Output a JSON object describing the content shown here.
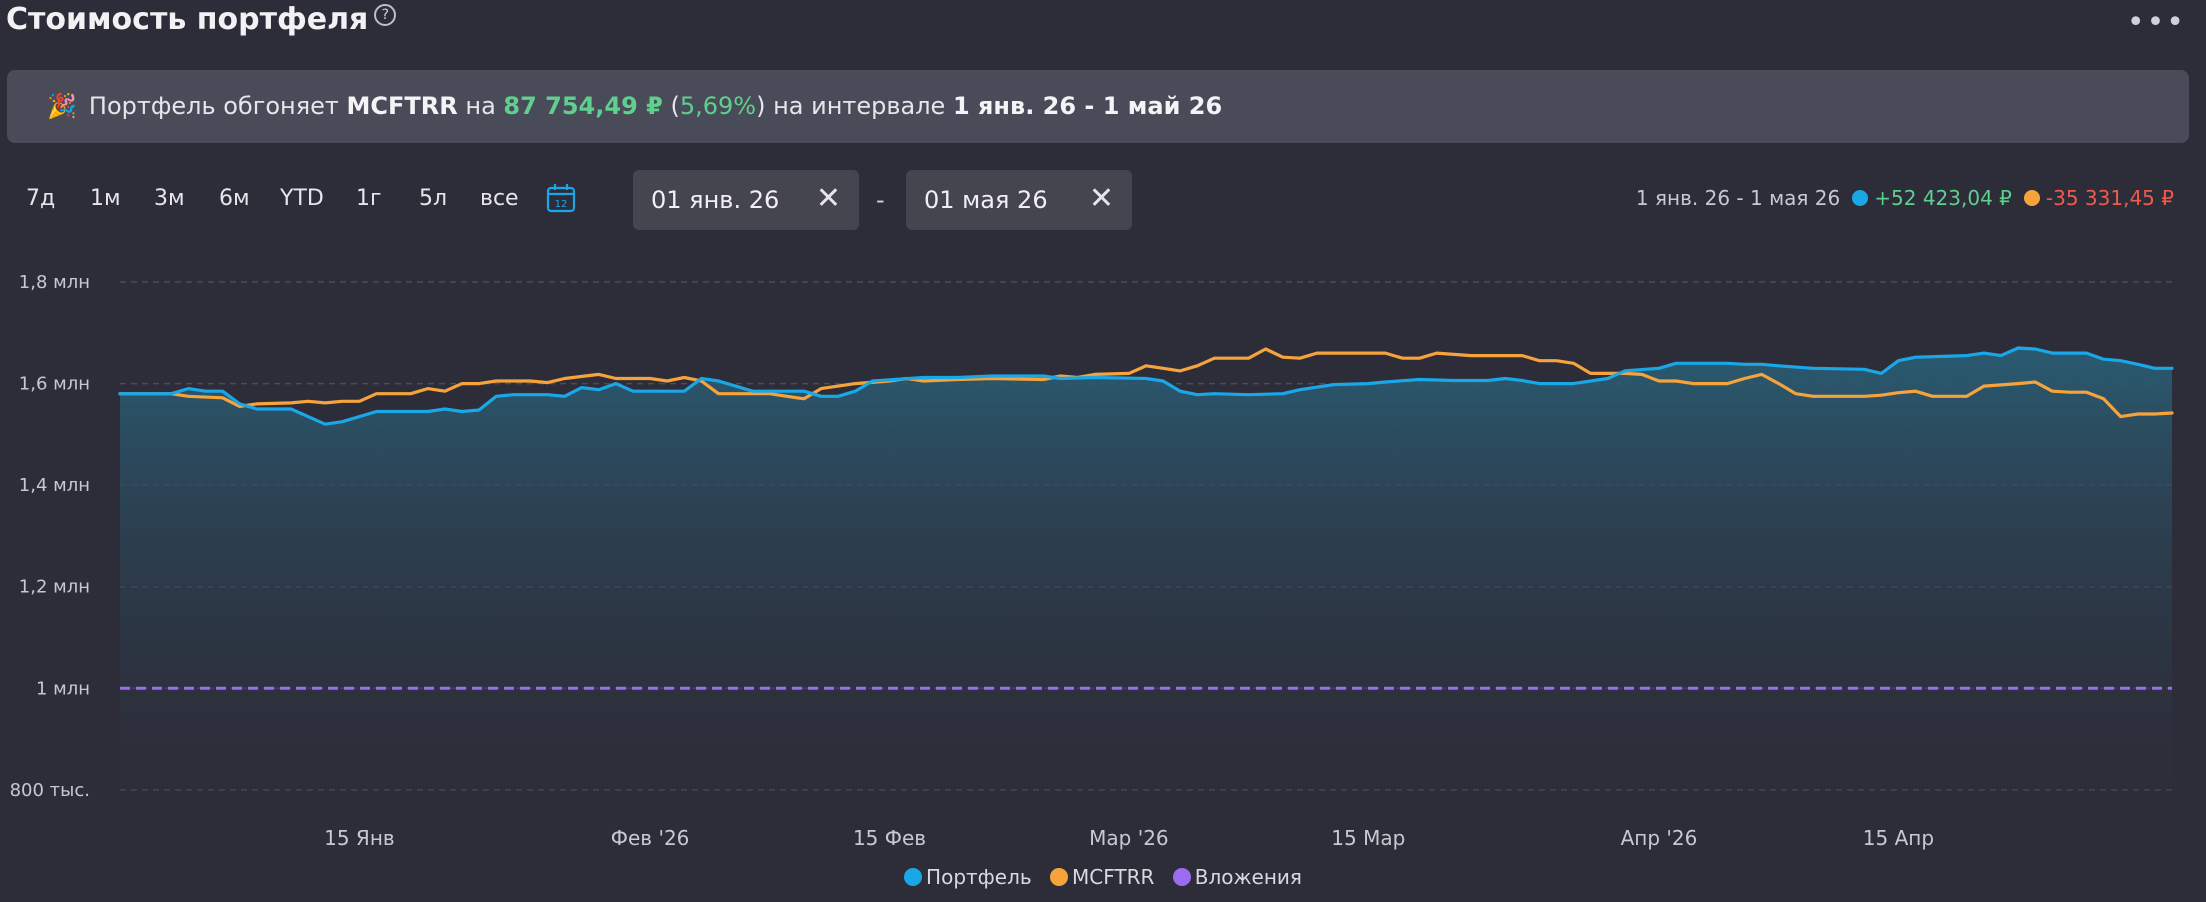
{
  "header": {
    "title": "Стоимость портфеля",
    "help_icon": "?",
    "more_icon": "•••"
  },
  "banner": {
    "emoji": "🎉",
    "t1": "Портфель обгоняет ",
    "benchmark": "MCFTRR",
    "t2": " на ",
    "amount": "87 754,49 ₽",
    "t3": " (",
    "pct": "5,69%",
    "t4": ") на интервале ",
    "interval": "1 янв. 26 - 1 май 26"
  },
  "ranges": [
    "7д",
    "1м",
    "3м",
    "6м",
    "YTD",
    "1г",
    "5л",
    "все"
  ],
  "calendar_icon": "12",
  "date_from": "01 янв. 26",
  "date_to": "01 мая 26",
  "date_sep": "-",
  "summary": {
    "interval": "1 янв. 26 - 1 мая 26",
    "portfolio_change": "+52 423,04 ₽",
    "benchmark_change": "-35 331,45 ₽"
  },
  "colors": {
    "portfolio": "#1aa7e8",
    "benchmark": "#f7a33b",
    "investments": "#9b6cf0",
    "area_top": "#2a5d74",
    "area_bottom": "#2d2d39",
    "grid": "#4b4c5a",
    "positive": "#5fcf8e",
    "negative": "#f05a4a"
  },
  "chart_data": {
    "type": "line",
    "y_ticks": [
      "1,8 млн",
      "1,6 млн",
      "1,4 млн",
      "1,2 млн",
      "1 млн",
      "800 тыс."
    ],
    "y_tick_values": [
      1800000,
      1600000,
      1400000,
      1200000,
      1000000,
      800000
    ],
    "ylim": [
      780000,
      1800000
    ],
    "xlim": [
      "2026-01-01",
      "2026-05-01"
    ],
    "x_ticks": [
      {
        "date": "2026-01-15",
        "label": "15 Янв"
      },
      {
        "date": "2026-02-01",
        "label": "Фев '26"
      },
      {
        "date": "2026-02-15",
        "label": "15 Фев"
      },
      {
        "date": "2026-03-01",
        "label": "Мар '26"
      },
      {
        "date": "2026-03-15",
        "label": "15 Мар"
      },
      {
        "date": "2026-04-01",
        "label": "Апр '26"
      },
      {
        "date": "2026-04-15",
        "label": "15 Апр"
      }
    ],
    "series": [
      {
        "name": "Портфель",
        "area": true,
        "points": [
          [
            "2026-01-01",
            1580000
          ],
          [
            "2026-01-04",
            1580000
          ],
          [
            "2026-01-05",
            1590000
          ],
          [
            "2026-01-06",
            1585000
          ],
          [
            "2026-01-07",
            1585000
          ],
          [
            "2026-01-08",
            1560000
          ],
          [
            "2026-01-09",
            1550000
          ],
          [
            "2026-01-11",
            1550000
          ],
          [
            "2026-01-13",
            1520000
          ],
          [
            "2026-01-14",
            1525000
          ],
          [
            "2026-01-16",
            1545000
          ],
          [
            "2026-01-19",
            1545000
          ],
          [
            "2026-01-20",
            1550000
          ],
          [
            "2026-01-21",
            1545000
          ],
          [
            "2026-01-22",
            1548000
          ],
          [
            "2026-01-23",
            1575000
          ],
          [
            "2026-01-24",
            1578000
          ],
          [
            "2026-01-26",
            1578000
          ],
          [
            "2026-01-27",
            1575000
          ],
          [
            "2026-01-28",
            1592000
          ],
          [
            "2026-01-29",
            1588000
          ],
          [
            "2026-01-30",
            1600000
          ],
          [
            "2026-01-31",
            1585000
          ],
          [
            "2026-02-03",
            1585000
          ],
          [
            "2026-02-04",
            1610000
          ],
          [
            "2026-02-05",
            1605000
          ],
          [
            "2026-02-07",
            1585000
          ],
          [
            "2026-02-10",
            1585000
          ],
          [
            "2026-02-11",
            1575000
          ],
          [
            "2026-02-12",
            1575000
          ],
          [
            "2026-02-13",
            1585000
          ],
          [
            "2026-02-14",
            1605000
          ],
          [
            "2026-02-17",
            1612000
          ],
          [
            "2026-02-19",
            1612000
          ],
          [
            "2026-02-21",
            1615000
          ],
          [
            "2026-02-24",
            1615000
          ],
          [
            "2026-02-25",
            1610000
          ],
          [
            "2026-02-27",
            1612000
          ],
          [
            "2026-03-02",
            1610000
          ],
          [
            "2026-03-03",
            1605000
          ],
          [
            "2026-03-04",
            1585000
          ],
          [
            "2026-03-05",
            1578000
          ],
          [
            "2026-03-06",
            1580000
          ],
          [
            "2026-03-08",
            1578000
          ],
          [
            "2026-03-10",
            1580000
          ],
          [
            "2026-03-11",
            1588000
          ],
          [
            "2026-03-13",
            1598000
          ],
          [
            "2026-03-15",
            1600000
          ],
          [
            "2026-03-16",
            1603000
          ],
          [
            "2026-03-18",
            1608000
          ],
          [
            "2026-03-20",
            1606000
          ],
          [
            "2026-03-22",
            1606000
          ],
          [
            "2026-03-23",
            1610000
          ],
          [
            "2026-03-24",
            1606000
          ],
          [
            "2026-03-25",
            1600000
          ],
          [
            "2026-03-27",
            1600000
          ],
          [
            "2026-03-29",
            1610000
          ],
          [
            "2026-03-30",
            1625000
          ],
          [
            "2026-04-01",
            1630000
          ],
          [
            "2026-04-02",
            1640000
          ],
          [
            "2026-04-05",
            1640000
          ],
          [
            "2026-04-06",
            1638000
          ],
          [
            "2026-04-07",
            1638000
          ],
          [
            "2026-04-08",
            1635000
          ],
          [
            "2026-04-10",
            1630000
          ],
          [
            "2026-04-13",
            1628000
          ],
          [
            "2026-04-14",
            1620000
          ],
          [
            "2026-04-15",
            1645000
          ],
          [
            "2026-04-16",
            1652000
          ],
          [
            "2026-04-19",
            1655000
          ],
          [
            "2026-04-20",
            1660000
          ],
          [
            "2026-04-21",
            1655000
          ],
          [
            "2026-04-22",
            1670000
          ],
          [
            "2026-04-23",
            1668000
          ],
          [
            "2026-04-24",
            1660000
          ],
          [
            "2026-04-26",
            1660000
          ],
          [
            "2026-04-27",
            1648000
          ],
          [
            "2026-04-28",
            1645000
          ],
          [
            "2026-04-29",
            1638000
          ],
          [
            "2026-04-30",
            1630000
          ],
          [
            "2026-05-01",
            1630000
          ]
        ]
      },
      {
        "name": "MCFTRR",
        "points": [
          [
            "2026-01-01",
            1580000
          ],
          [
            "2026-01-04",
            1580000
          ],
          [
            "2026-01-05",
            1575000
          ],
          [
            "2026-01-07",
            1572000
          ],
          [
            "2026-01-08",
            1555000
          ],
          [
            "2026-01-09",
            1560000
          ],
          [
            "2026-01-11",
            1562000
          ],
          [
            "2026-01-12",
            1565000
          ],
          [
            "2026-01-13",
            1562000
          ],
          [
            "2026-01-14",
            1565000
          ],
          [
            "2026-01-15",
            1565000
          ],
          [
            "2026-01-16",
            1580000
          ],
          [
            "2026-01-18",
            1580000
          ],
          [
            "2026-01-19",
            1590000
          ],
          [
            "2026-01-20",
            1585000
          ],
          [
            "2026-01-21",
            1600000
          ],
          [
            "2026-01-22",
            1600000
          ],
          [
            "2026-01-23",
            1605000
          ],
          [
            "2026-01-25",
            1605000
          ],
          [
            "2026-01-26",
            1602000
          ],
          [
            "2026-01-27",
            1610000
          ],
          [
            "2026-01-29",
            1618000
          ],
          [
            "2026-01-30",
            1610000
          ],
          [
            "2026-02-01",
            1610000
          ],
          [
            "2026-02-02",
            1605000
          ],
          [
            "2026-02-03",
            1612000
          ],
          [
            "2026-02-04",
            1605000
          ],
          [
            "2026-02-05",
            1580000
          ],
          [
            "2026-02-08",
            1580000
          ],
          [
            "2026-02-09",
            1575000
          ],
          [
            "2026-02-10",
            1570000
          ],
          [
            "2026-02-11",
            1590000
          ],
          [
            "2026-02-13",
            1600000
          ],
          [
            "2026-02-15",
            1605000
          ],
          [
            "2026-02-16",
            1610000
          ],
          [
            "2026-02-17",
            1605000
          ],
          [
            "2026-02-19",
            1608000
          ],
          [
            "2026-02-21",
            1610000
          ],
          [
            "2026-02-24",
            1608000
          ],
          [
            "2026-02-25",
            1615000
          ],
          [
            "2026-02-26",
            1612000
          ],
          [
            "2026-02-27",
            1618000
          ],
          [
            "2026-03-01",
            1620000
          ],
          [
            "2026-03-02",
            1635000
          ],
          [
            "2026-03-03",
            1630000
          ],
          [
            "2026-03-04",
            1625000
          ],
          [
            "2026-03-05",
            1635000
          ],
          [
            "2026-03-06",
            1650000
          ],
          [
            "2026-03-08",
            1650000
          ],
          [
            "2026-03-09",
            1668000
          ],
          [
            "2026-03-10",
            1652000
          ],
          [
            "2026-03-11",
            1650000
          ],
          [
            "2026-03-12",
            1660000
          ],
          [
            "2026-03-16",
            1660000
          ],
          [
            "2026-03-17",
            1650000
          ],
          [
            "2026-03-18",
            1650000
          ],
          [
            "2026-03-19",
            1660000
          ],
          [
            "2026-03-21",
            1655000
          ],
          [
            "2026-03-24",
            1655000
          ],
          [
            "2026-03-25",
            1645000
          ],
          [
            "2026-03-26",
            1645000
          ],
          [
            "2026-03-27",
            1640000
          ],
          [
            "2026-03-28",
            1620000
          ],
          [
            "2026-03-30",
            1620000
          ],
          [
            "2026-03-31",
            1618000
          ],
          [
            "2026-04-01",
            1605000
          ],
          [
            "2026-04-02",
            1605000
          ],
          [
            "2026-04-03",
            1600000
          ],
          [
            "2026-04-05",
            1600000
          ],
          [
            "2026-04-06",
            1610000
          ],
          [
            "2026-04-07",
            1618000
          ],
          [
            "2026-04-08",
            1600000
          ],
          [
            "2026-04-09",
            1580000
          ],
          [
            "2026-04-10",
            1575000
          ],
          [
            "2026-04-13",
            1575000
          ],
          [
            "2026-04-14",
            1577000
          ],
          [
            "2026-04-15",
            1582000
          ],
          [
            "2026-04-16",
            1585000
          ],
          [
            "2026-04-17",
            1575000
          ],
          [
            "2026-04-19",
            1575000
          ],
          [
            "2026-04-20",
            1595000
          ],
          [
            "2026-04-22",
            1600000
          ],
          [
            "2026-04-23",
            1603000
          ],
          [
            "2026-04-24",
            1585000
          ],
          [
            "2026-04-25",
            1583000
          ],
          [
            "2026-04-26",
            1583000
          ],
          [
            "2026-04-27",
            1570000
          ],
          [
            "2026-04-28",
            1535000
          ],
          [
            "2026-04-29",
            1540000
          ],
          [
            "2026-04-30",
            1540000
          ],
          [
            "2026-05-01",
            1542000
          ]
        ]
      },
      {
        "name": "Вложения",
        "dashed": true,
        "points": [
          [
            "2026-01-01",
            1000000
          ],
          [
            "2026-05-01",
            1000000
          ]
        ]
      }
    ],
    "legend": [
      "Портфель",
      "MCFTRR",
      "Вложения"
    ],
    "grid": true,
    "legend_position": "bottom"
  }
}
